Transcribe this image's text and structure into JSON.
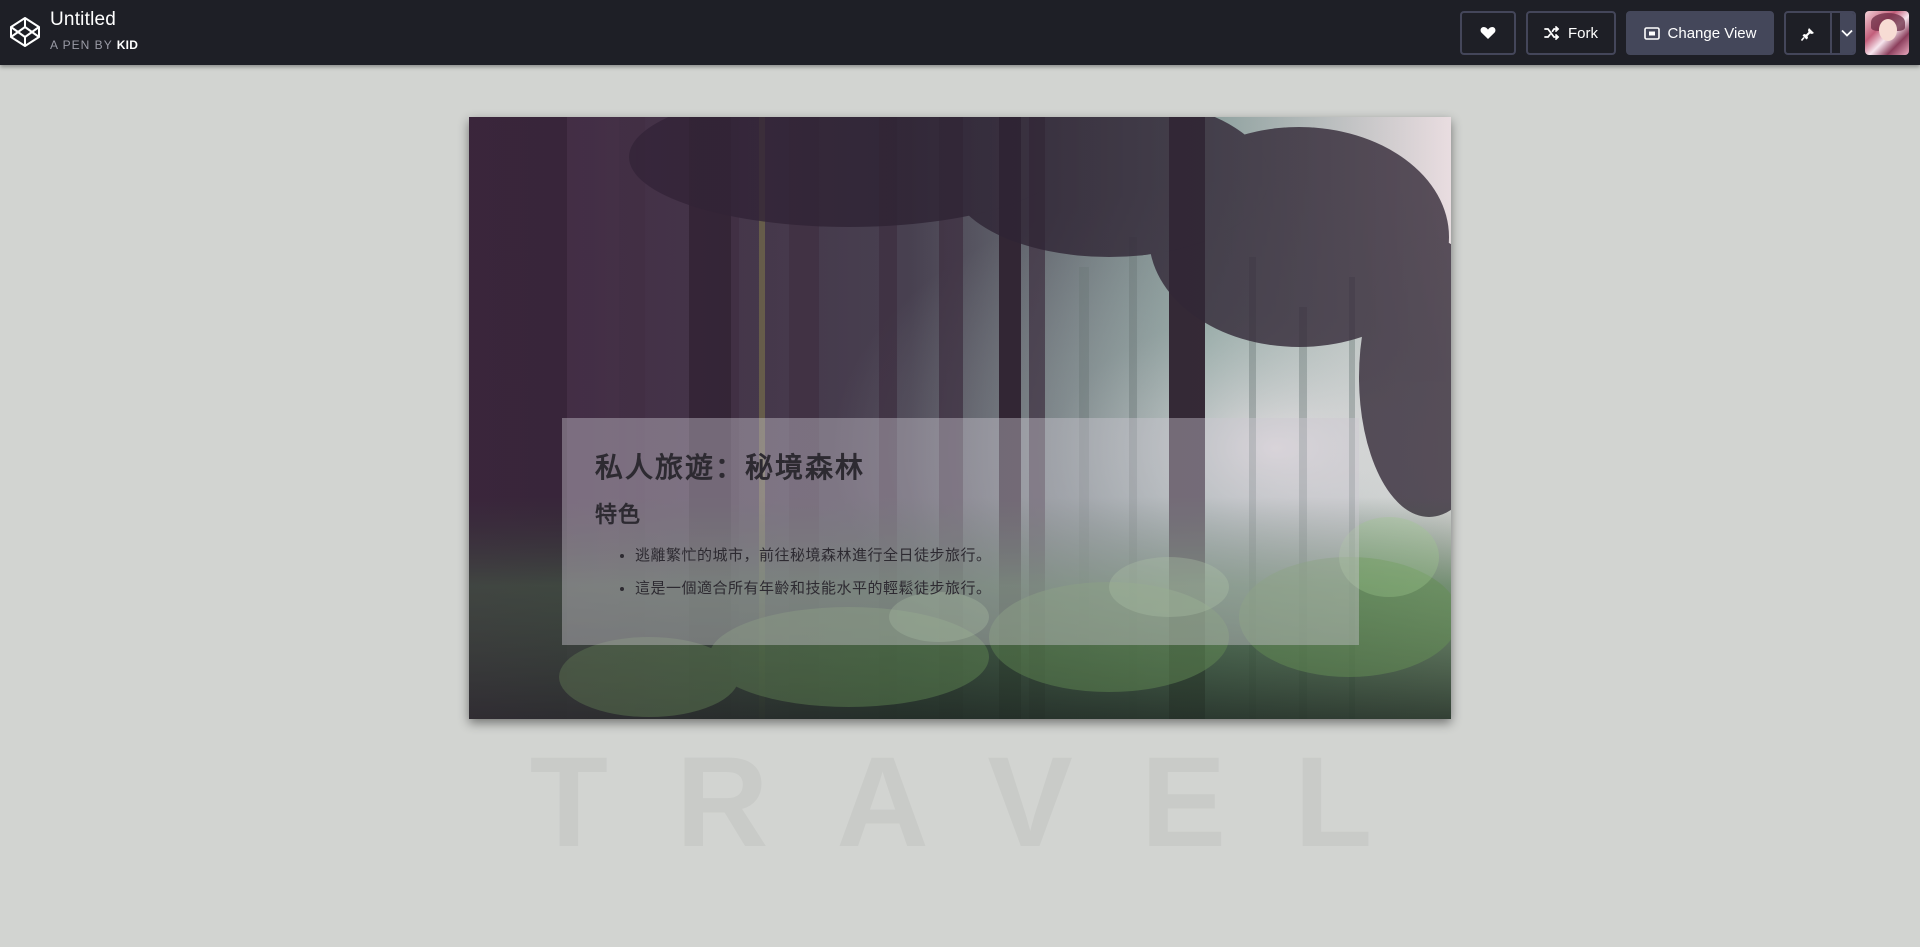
{
  "header": {
    "title": "Untitled",
    "byline_prefix": "A PEN BY",
    "author": "KID",
    "buttons": {
      "heart_icon": "heart-icon",
      "fork_label": "Fork",
      "fork_icon": "fork-icon",
      "change_view_label": "Change View",
      "change_view_icon": "view-icon",
      "pin_icon": "pin-icon",
      "dropdown_icon": "chevron-down-icon"
    }
  },
  "card": {
    "title": "私人旅遊：秘境森林",
    "subtitle": "特色",
    "features": [
      "逃離繁忙的城市，前往秘境森林進行全日徒步旅行。",
      "這是一個適合所有年齡和技能水平的輕鬆徒步旅行。"
    ]
  },
  "banner_word": "TRAVEL",
  "colors": {
    "topbar_bg": "#1e1f26",
    "page_bg": "#d2d4d1",
    "button_border": "#44465a",
    "active_button_bg": "#44475a",
    "banner_text": "#c9cbc8",
    "card_text": "#2d2a31"
  }
}
